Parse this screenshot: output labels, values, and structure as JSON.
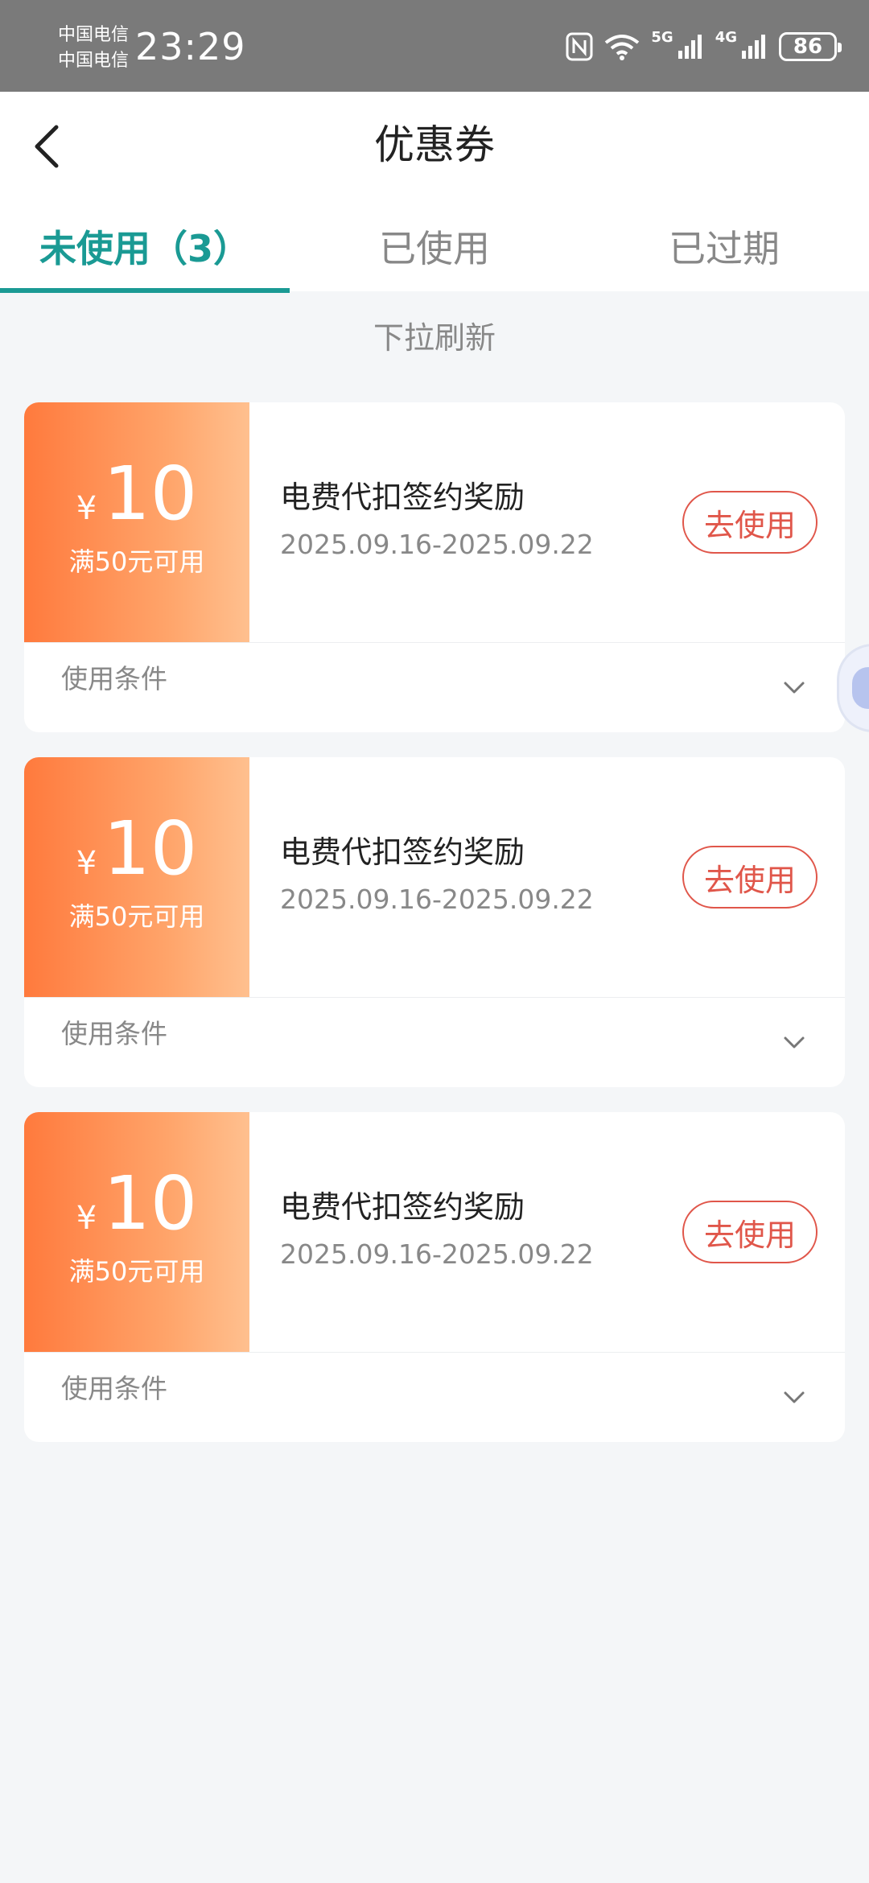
{
  "status_bar": {
    "carrier1": "中国电信",
    "carrier2": "中国电信",
    "time": "23:29",
    "network1": "5G",
    "network2": "4G",
    "battery": "86"
  },
  "header": {
    "title": "优惠券"
  },
  "tabs": [
    {
      "label": "未使用（3）",
      "active": true
    },
    {
      "label": "已使用",
      "active": false
    },
    {
      "label": "已过期",
      "active": false
    }
  ],
  "refresh_hint": "下拉刷新",
  "coupons": [
    {
      "currency": "¥",
      "amount": "10",
      "condition": "满50元可用",
      "title": "电费代扣签约奖励",
      "date_range": "2025.09.16-2025.09.22",
      "use_label": "去使用",
      "terms_label": "使用条件"
    },
    {
      "currency": "¥",
      "amount": "10",
      "condition": "满50元可用",
      "title": "电费代扣签约奖励",
      "date_range": "2025.09.16-2025.09.22",
      "use_label": "去使用",
      "terms_label": "使用条件"
    },
    {
      "currency": "¥",
      "amount": "10",
      "condition": "满50元可用",
      "title": "电费代扣签约奖励",
      "date_range": "2025.09.16-2025.09.22",
      "use_label": "去使用",
      "terms_label": "使用条件"
    }
  ],
  "colors": {
    "accent": "#1a9a94",
    "coupon_orange": "#ff7a3d",
    "use_button": "#e0564a"
  },
  "icons": [
    "chevron-left-icon",
    "nfc-icon",
    "wifi-icon",
    "signal-icon",
    "chevron-down-icon"
  ]
}
